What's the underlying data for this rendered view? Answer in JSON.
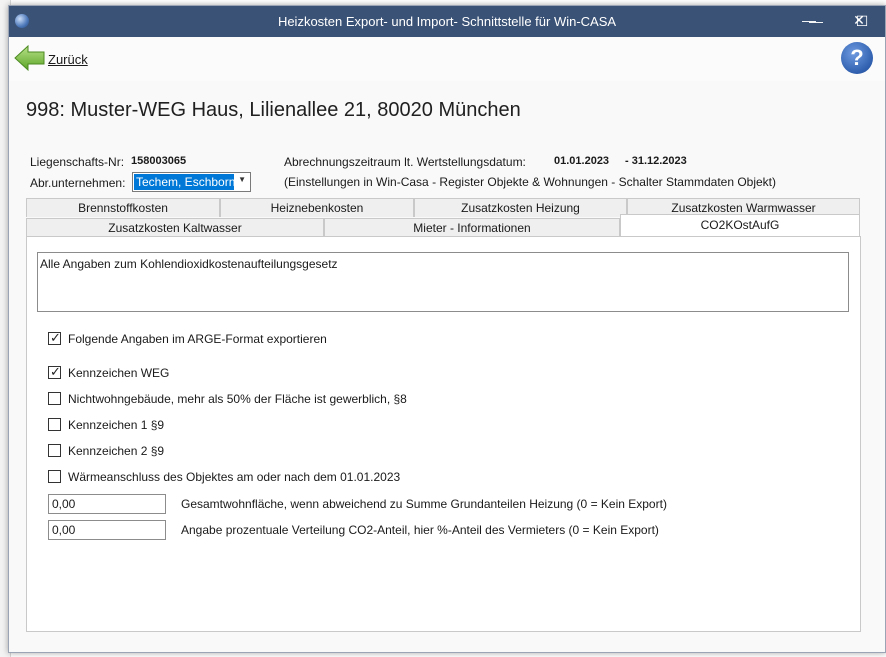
{
  "window": {
    "title": "Heizkosten Export- und Import- Schnittstelle für Win-CASA",
    "minimize": "—",
    "maximize": "☐",
    "close": "✕"
  },
  "toolbar": {
    "back_label": "Zurück",
    "help": "?"
  },
  "header": {
    "title": "998: Muster-WEG Haus, Lilienallee 21, 80020 München"
  },
  "info": {
    "liegenschaft_label": "Liegenschafts-Nr:",
    "liegenschaft_value": "158003065",
    "abrechnung_label": "Abrechnungszeitraum lt. Wertstellungsdatum:",
    "start_date": "01.01.2023",
    "end_date": "-  31.12.2023",
    "unternehmen_label": "Abr.unternehmen:",
    "unternehmen_value": "Techem, Eschborn",
    "hint": "(Einstellungen in Win-Casa - Register Objekte & Wohnungen - Schalter Stammdaten Objekt)"
  },
  "tabs": {
    "row1": [
      "Brennstoffkosten",
      "Heiznebenkosten",
      "Zusatzkosten Heizung",
      "Zusatzkosten Warmwasser"
    ],
    "row2": [
      "Zusatzkosten Kaltwasser",
      "Mieter -  Informationen",
      "CO2KOstAufG"
    ]
  },
  "panel": {
    "description": "Alle Angaben zum Kohlendioxidkostenaufteilungsgesetz",
    "checkboxes": [
      {
        "label": "Folgende Angaben im ARGE-Format exportieren",
        "checked": true
      },
      {
        "label": "Kennzeichen WEG",
        "checked": true
      },
      {
        "label": "Nichtwohngebäude, mehr als 50% der Fläche ist gewerblich, §8",
        "checked": false
      },
      {
        "label": "Kennzeichen 1 §9",
        "checked": false
      },
      {
        "label": "Kennzeichen 2 §9",
        "checked": false
      },
      {
        "label": "Wärmeanschluss des Objektes am oder nach dem 01.01.2023",
        "checked": false
      }
    ],
    "fields": [
      {
        "value": "0,00",
        "label": "Gesamtwohnfläche, wenn abweichend zu Summe Grundanteilen Heizung (0 = Kein Export)"
      },
      {
        "value": "0,00",
        "label": "Angabe prozentuale Verteilung CO2-Anteil, hier %-Anteil des Vermieters (0 = Kein Export)"
      }
    ]
  },
  "colors": {
    "titlebar": "#3a5276",
    "selection": "#0078d7"
  }
}
